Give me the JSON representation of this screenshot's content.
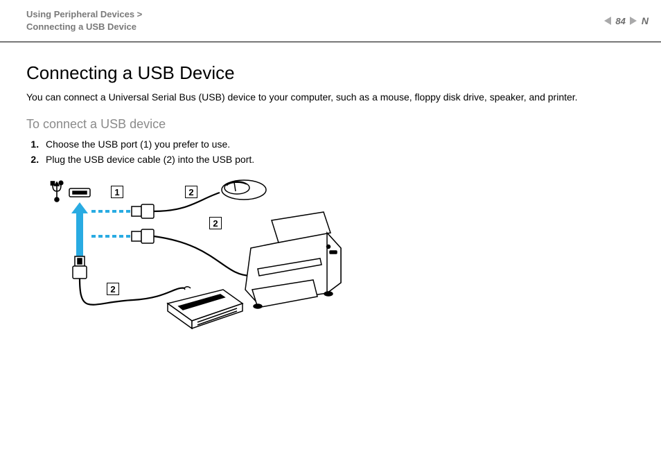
{
  "header": {
    "breadcrumb_line1": "Using Peripheral Devices >",
    "breadcrumb_line2": "Connecting a USB Device",
    "page_number": "84",
    "n_mark": "N"
  },
  "body": {
    "title": "Connecting a USB Device",
    "intro": "You can connect a Universal Serial Bus (USB) device to your computer, such as a mouse, floppy disk drive, speaker, and printer.",
    "subtitle": "To connect a USB device",
    "steps": [
      "Choose the USB port (1) you prefer to use.",
      "Plug the USB device cable (2) into the USB port."
    ]
  },
  "diagram": {
    "callouts": {
      "port": "1",
      "cable_top": "2",
      "cable_mid": "2",
      "cable_bottom": "2"
    }
  }
}
